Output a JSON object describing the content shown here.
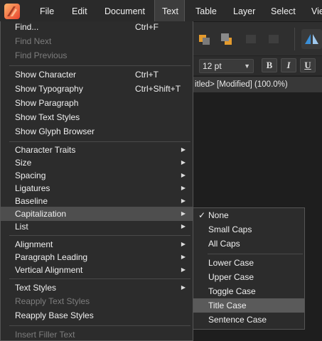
{
  "menubar": {
    "items": [
      "File",
      "Edit",
      "Document",
      "Text",
      "Table",
      "Layer",
      "Select",
      "Vie"
    ],
    "active": "Text"
  },
  "context": {
    "font_size": "12 pt",
    "style_buttons": [
      "B",
      "I",
      "U"
    ],
    "doc_title": "itled> [Modified] (100.0%)"
  },
  "text_menu": {
    "find": "Find...",
    "find_shortcut": "Ctrl+F",
    "find_next": "Find Next",
    "find_previous": "Find Previous",
    "show_character": "Show Character",
    "show_character_shortcut": "Ctrl+T",
    "show_typography": "Show Typography",
    "show_typography_shortcut": "Ctrl+Shift+T",
    "show_paragraph": "Show Paragraph",
    "show_text_styles": "Show Text Styles",
    "show_glyph_browser": "Show Glyph Browser",
    "character_traits": "Character Traits",
    "size": "Size",
    "spacing": "Spacing",
    "ligatures": "Ligatures",
    "baseline": "Baseline",
    "capitalization": "Capitalization",
    "list": "List",
    "alignment": "Alignment",
    "paragraph_leading": "Paragraph Leading",
    "vertical_alignment": "Vertical Alignment",
    "text_styles": "Text Styles",
    "reapply_text_styles": "Reapply Text Styles",
    "reapply_base_styles": "Reapply Base Styles",
    "insert_filler_text": "Insert Filler Text"
  },
  "capitalization_menu": {
    "checked_glyph": "✓",
    "none": "None",
    "small_caps": "Small Caps",
    "all_caps": "All Caps",
    "lower_case": "Lower Case",
    "upper_case": "Upper Case",
    "toggle_case": "Toggle Case",
    "title_case": "Title Case",
    "sentence_case": "Sentence Case"
  },
  "colors": {
    "logo_gradient": [
      "#ffb36b",
      "#e8422c"
    ],
    "accent_blue": "#3a8fd8"
  }
}
